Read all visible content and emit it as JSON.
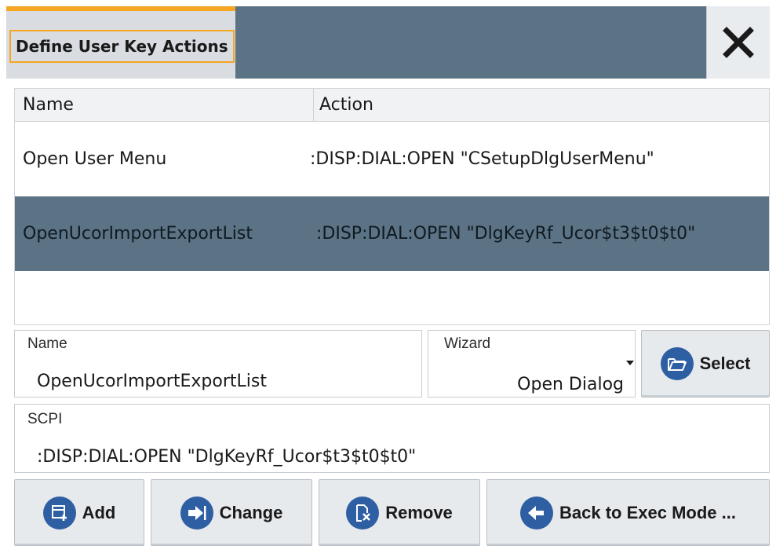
{
  "dialog": {
    "title": "Define User Key Actions",
    "close_icon": "close-icon",
    "accent_color": "#f5a623",
    "header_color": "#5b7384"
  },
  "table": {
    "columns": [
      "Name",
      "Action"
    ],
    "rows": [
      {
        "name": "Open User Menu",
        "action": ":DISP:DIAL:OPEN \"CSetupDlgUserMenu\"",
        "selected": false
      },
      {
        "name": "OpenUcorImportExportList",
        "action": ":DISP:DIAL:OPEN \"DlgKeyRf_Ucor$t3$t0$t0\"",
        "selected": true
      }
    ],
    "selected_row_color": "#5b7384"
  },
  "form": {
    "name_label": "Name",
    "name_value": "OpenUcorImportExportList",
    "wizard_label": "Wizard",
    "wizard_value": "Open Dialog",
    "select_label": "Select",
    "select_icon": "folder-open-icon",
    "scpi_label": "SCPI",
    "scpi_value": ":DISP:DIAL:OPEN \"DlgKeyRf_Ucor$t3$t0$t0\""
  },
  "buttons": {
    "add": {
      "label": "Add",
      "icon": "add-list-icon"
    },
    "change": {
      "label": "Change",
      "icon": "arrow-right-bar-icon"
    },
    "remove": {
      "label": "Remove",
      "icon": "remove-doc-icon"
    },
    "back": {
      "label": "Back to Exec Mode ...",
      "icon": "arrow-left-icon"
    },
    "icon_color": "#2f5fa3"
  }
}
